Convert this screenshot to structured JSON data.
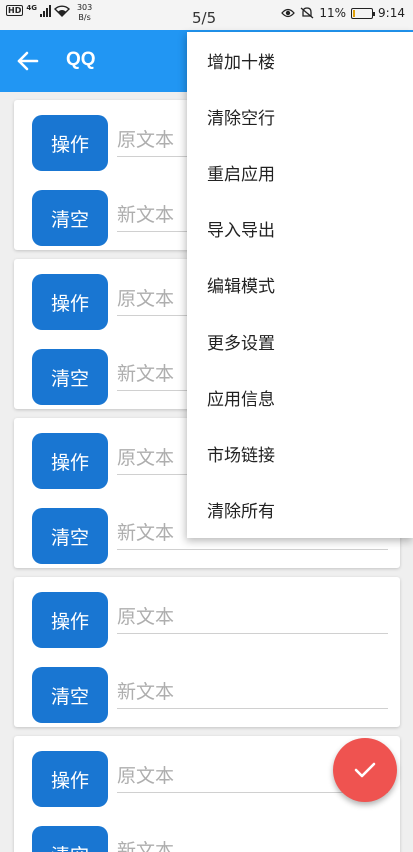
{
  "status_bar": {
    "hd": "HD",
    "network": "4G",
    "speed_value": "303",
    "speed_unit": "B/s",
    "page_indicator": "5/5",
    "battery_text": "11%",
    "battery_level": 0.11,
    "time": "9:14"
  },
  "app_bar": {
    "title": "QQ",
    "back_icon": "arrow-back-icon"
  },
  "cards": [
    {
      "op_label": "操作",
      "original_placeholder": "原文本",
      "clear_label": "清空",
      "new_placeholder": "新文本"
    },
    {
      "op_label": "操作",
      "original_placeholder": "原文本",
      "clear_label": "清空",
      "new_placeholder": "新文本"
    },
    {
      "op_label": "操作",
      "original_placeholder": "原文本",
      "clear_label": "清空",
      "new_placeholder": "新文本"
    },
    {
      "op_label": "操作",
      "original_placeholder": "原文本",
      "clear_label": "清空",
      "new_placeholder": "新文本"
    },
    {
      "op_label": "操作",
      "original_placeholder": "原文本",
      "clear_label": "清空",
      "new_placeholder": "新文本"
    }
  ],
  "menu": {
    "items": [
      "增加十楼",
      "清除空行",
      "重启应用",
      "导入导出",
      "编辑模式",
      "更多设置",
      "应用信息",
      "市场链接",
      "清除所有"
    ]
  },
  "fab": {
    "icon": "check-icon"
  },
  "colors": {
    "primary": "#2196f3",
    "button": "#1976d2",
    "fab": "#ef5350"
  }
}
